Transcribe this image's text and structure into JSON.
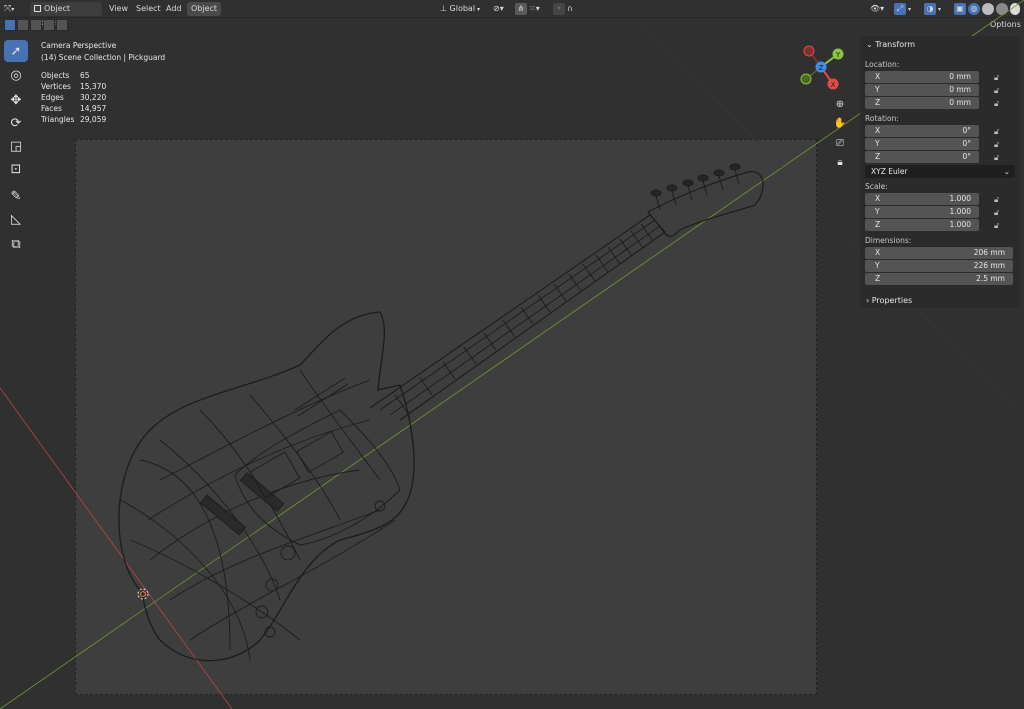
{
  "header": {
    "editor_type_icon": "axis-3d-icon",
    "mode_label": "Object Mode",
    "menus": [
      "View",
      "Select",
      "Add",
      "Object"
    ],
    "transform_orientation": "Global",
    "options_label": "Options"
  },
  "overlay": {
    "view_name": "Camera Perspective",
    "collection_line": "(14) Scene Collection | Pickguard",
    "stats": [
      {
        "key": "Objects",
        "value": "65"
      },
      {
        "key": "Vertices",
        "value": "15,370"
      },
      {
        "key": "Edges",
        "value": "30,220"
      },
      {
        "key": "Faces",
        "value": "14,957"
      },
      {
        "key": "Triangles",
        "value": "29,059"
      }
    ]
  },
  "tools": [
    {
      "name": "select-box-tool",
      "icon": "cursor-icon"
    },
    {
      "name": "cursor-tool",
      "icon": "crosshair-icon"
    },
    {
      "name": "move-tool",
      "icon": "move-icon"
    },
    {
      "name": "rotate-tool",
      "icon": "rotate-icon"
    },
    {
      "name": "scale-tool",
      "icon": "scale-icon"
    },
    {
      "name": "transform-tool",
      "icon": "transform-icon"
    },
    {
      "name": "annotate-tool",
      "icon": "pencil-icon"
    },
    {
      "name": "measure-tool",
      "icon": "ruler-icon"
    },
    {
      "name": "add-cube-tool",
      "icon": "cube-add-icon"
    }
  ],
  "gizmo": {
    "x": "X",
    "y": "Y",
    "z": "Z"
  },
  "npanel": {
    "title": "Transform",
    "location_label": "Location:",
    "location": [
      {
        "axis": "X",
        "value": "0 mm"
      },
      {
        "axis": "Y",
        "value": "0 mm"
      },
      {
        "axis": "Z",
        "value": "0 mm"
      }
    ],
    "rotation_label": "Rotation:",
    "rotation": [
      {
        "axis": "X",
        "value": "0°"
      },
      {
        "axis": "Y",
        "value": "0°"
      },
      {
        "axis": "Z",
        "value": "0°"
      }
    ],
    "rotation_mode": "XYZ Euler",
    "scale_label": "Scale:",
    "scale": [
      {
        "axis": "X",
        "value": "1.000"
      },
      {
        "axis": "Y",
        "value": "1.000"
      },
      {
        "axis": "Z",
        "value": "1.000"
      }
    ],
    "dimensions_label": "Dimensions:",
    "dimensions": [
      {
        "axis": "X",
        "value": "206 mm"
      },
      {
        "axis": "Y",
        "value": "226 mm"
      },
      {
        "axis": "Z",
        "value": "2.5 mm"
      }
    ],
    "properties_label": "Properties"
  },
  "colors": {
    "accent": "#4772b3",
    "x_axis": "#e64a4a",
    "y_axis": "#8bc53f",
    "z_axis": "#3d8ee6"
  }
}
